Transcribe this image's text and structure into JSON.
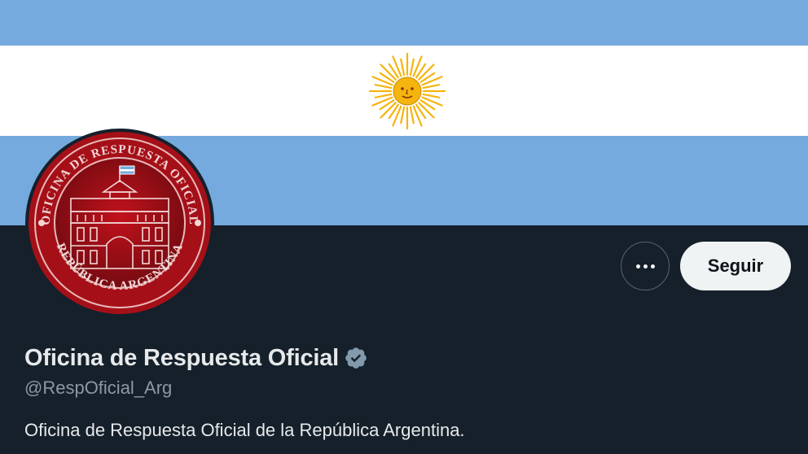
{
  "banner": {
    "colors": {
      "celeste": "#74aadd",
      "white": "#ffffff",
      "sun": "#f6b40e"
    },
    "icon": "sol-de-mayo-icon"
  },
  "avatar": {
    "icon": "casa-rosada-seal-icon",
    "seal_text": "OFICINA DE RESPUESTA OFICIAL · REPÚBLICA ARGENTINA",
    "colors": {
      "red": "#a51018",
      "dark_red": "#6e0a10"
    }
  },
  "actions": {
    "more_icon": "more-dots-icon",
    "follow_label": "Seguir"
  },
  "profile": {
    "display_name": "Oficina de Respuesta Oficial",
    "verified_icon": "verified-badge-icon",
    "handle": "@RespOficial_Arg",
    "bio": "Oficina de Respuesta Oficial de la República Argentina."
  },
  "theme": {
    "background": "#15202b",
    "text": "#e7e9ea",
    "muted": "#8b98a5",
    "button_bg": "#eff3f4"
  }
}
